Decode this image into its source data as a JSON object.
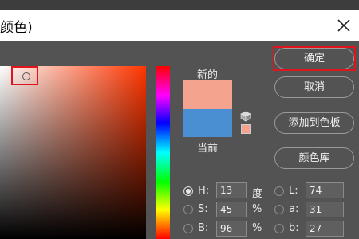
{
  "window": {
    "title": "颜色)",
    "close_icon": "close-icon"
  },
  "swatches": {
    "new_label": "新的",
    "current_label": "当前",
    "new_color": "#f4a38e",
    "current_color": "#4a8fd1"
  },
  "buttons": {
    "ok": "确定",
    "cancel": "取消",
    "add_to_swatches": "添加到色板",
    "color_libraries": "颜色库"
  },
  "hsb": [
    {
      "label": "H:",
      "value": "13",
      "unit": "度",
      "selected": true
    },
    {
      "label": "S:",
      "value": "45",
      "unit": "%",
      "selected": false
    },
    {
      "label": "B:",
      "value": "96",
      "unit": "%",
      "selected": false
    }
  ],
  "lab": [
    {
      "label": "L:",
      "value": "74",
      "selected": false
    },
    {
      "label": "a:",
      "value": "31",
      "selected": false
    },
    {
      "label": "b:",
      "value": "27",
      "selected": false
    }
  ]
}
